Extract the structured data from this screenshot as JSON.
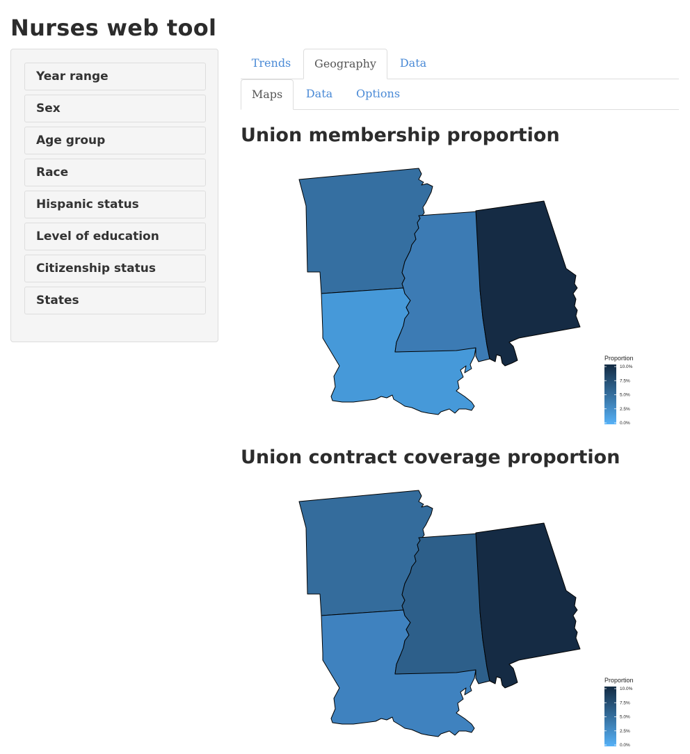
{
  "app": {
    "title": "Nurses web tool"
  },
  "sidebar": {
    "items": [
      {
        "label": "Year range"
      },
      {
        "label": "Sex"
      },
      {
        "label": "Age group"
      },
      {
        "label": "Race"
      },
      {
        "label": "Hispanic status"
      },
      {
        "label": "Level of education"
      },
      {
        "label": "Citizenship status"
      },
      {
        "label": "States"
      }
    ]
  },
  "tabs": {
    "main": [
      {
        "label": "Trends"
      },
      {
        "label": "Geography"
      },
      {
        "label": "Data"
      }
    ],
    "main_active": "Geography",
    "sub": [
      {
        "label": "Maps"
      },
      {
        "label": "Data"
      },
      {
        "label": "Options"
      }
    ],
    "sub_active": "Maps"
  },
  "maps": [
    {
      "title": "Union membership proportion",
      "legend": {
        "title": "Proportion",
        "ticks": [
          "10.0%",
          "7.5%",
          "5.0%",
          "2.5%",
          "0.0%"
        ]
      },
      "states": [
        {
          "name": "Arkansas",
          "color": "#356fa1"
        },
        {
          "name": "Louisiana",
          "color": "#4699d9"
        },
        {
          "name": "Mississippi",
          "color": "#3c7bb4"
        },
        {
          "name": "Alabama",
          "color": "#152b44"
        }
      ]
    },
    {
      "title": "Union contract coverage proportion",
      "legend": {
        "title": "Proportion",
        "ticks": [
          "10.0%",
          "7.5%",
          "5.0%",
          "2.5%",
          "0.0%"
        ]
      },
      "states": [
        {
          "name": "Arkansas",
          "color": "#346c9c"
        },
        {
          "name": "Louisiana",
          "color": "#3f82bf"
        },
        {
          "name": "Mississippi",
          "color": "#2d5f8a"
        },
        {
          "name": "Alabama",
          "color": "#152b44"
        }
      ]
    }
  ],
  "colors": {
    "accent": "#4a8ad6",
    "scale_low": "#56b1f7",
    "scale_high": "#132b43"
  }
}
